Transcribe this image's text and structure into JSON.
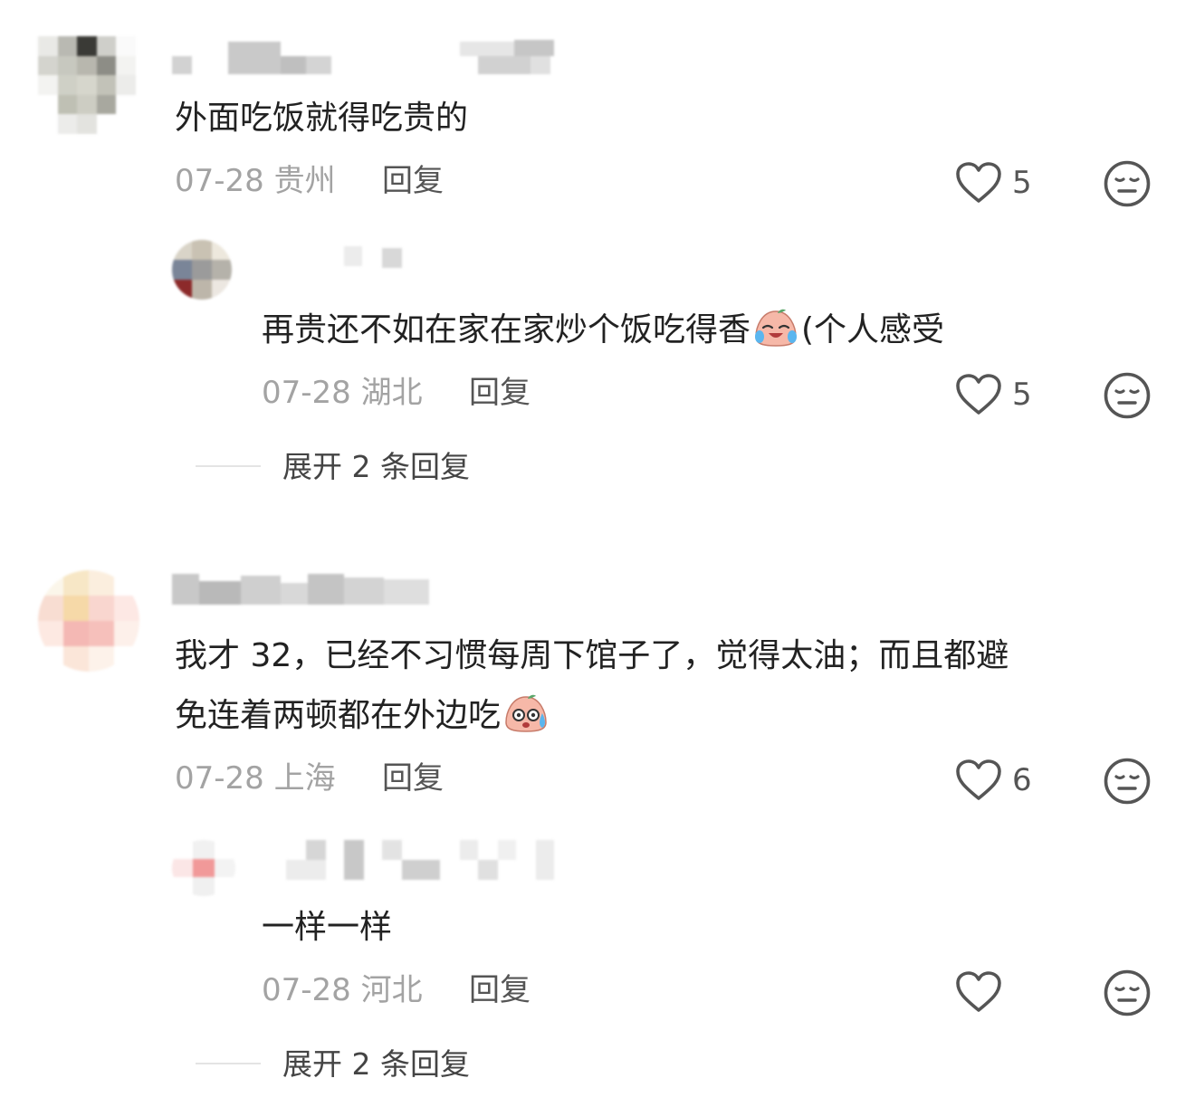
{
  "colors": {
    "text": "#222222",
    "meta": "#a3a3a3",
    "action": "#555555",
    "divider": "#e4e4e4"
  },
  "comments": [
    {
      "text": "外面吃饭就得吃贵的",
      "date": "07-28",
      "location": "贵州",
      "reply_label": "回复",
      "likes": "5",
      "replies": [
        {
          "text_before": "再贵还不如在家在家炒个饭吃得香",
          "emoji_icon": "crying-laughing-peach-emoji",
          "text_after": "(个人感受",
          "date": "07-28",
          "location": "湖北",
          "reply_label": "回复",
          "likes": "5"
        }
      ],
      "expand_label": "展开 2 条回复"
    },
    {
      "line1": "我才 32，已经不习惯每周下馆子了，觉得太油；而且都避",
      "line2": "免连着两顿都在外边吃",
      "emoji_icon": "sweating-peach-emoji",
      "date": "07-28",
      "location": "上海",
      "reply_label": "回复",
      "likes": "6",
      "replies": [
        {
          "text": "一样一样",
          "date": "07-28",
          "location": "河北",
          "reply_label": "回复",
          "likes": ""
        }
      ],
      "expand_label": "展开 2 条回复"
    }
  ]
}
